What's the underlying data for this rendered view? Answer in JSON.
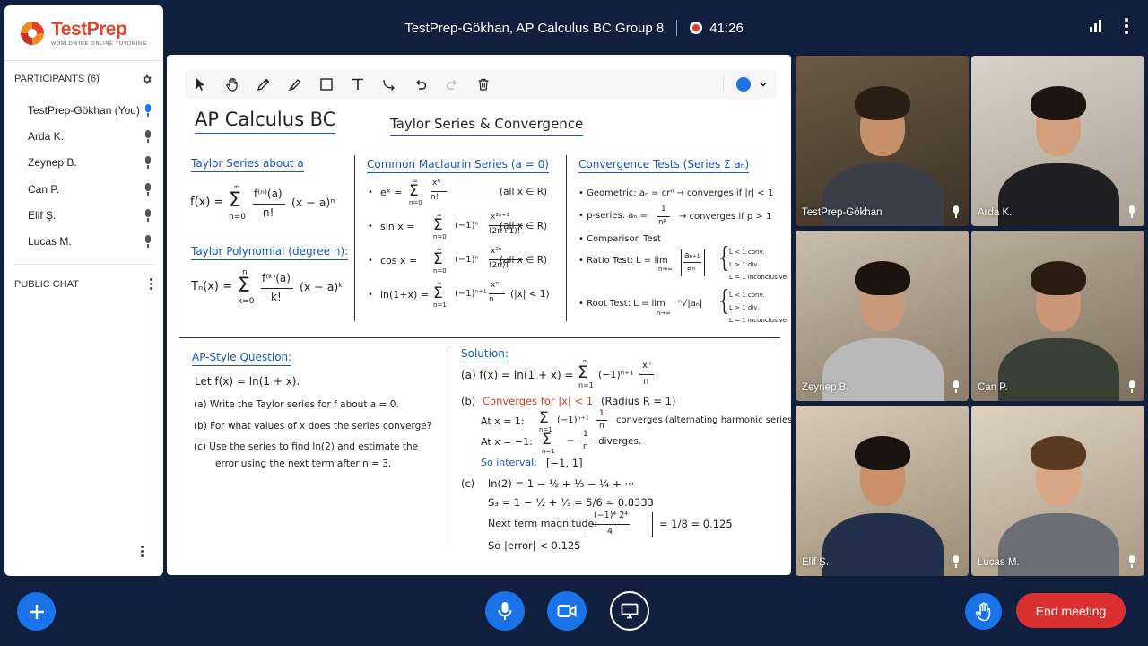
{
  "meeting": {
    "title": "TestPrep-Gökhan, AP Calculus BC Group 8",
    "recording_time": "41:26"
  },
  "brand": {
    "name_a": "Test",
    "name_b": "Prep",
    "tagline": "WORLDWIDE ONLINE TUTORING"
  },
  "sidebar": {
    "participants_header": "PARTICIPANTS (6)",
    "participants": [
      {
        "name": "TestPrep-Gökhan (You)",
        "mic_active": true
      },
      {
        "name": "Arda K.",
        "mic_active": false
      },
      {
        "name": "Zeynep B.",
        "mic_active": false
      },
      {
        "name": "Can P.",
        "mic_active": false
      },
      {
        "name": "Elif Ş.",
        "mic_active": false
      },
      {
        "name": "Lucas M.",
        "mic_active": false
      }
    ],
    "chat_header": "PUBLIC CHAT"
  },
  "whiteboard": {
    "tools": [
      "select-icon",
      "hand-icon",
      "pencil-icon",
      "marker-icon",
      "rectangle-icon",
      "text-icon",
      "connector-icon",
      "undo-icon",
      "redo-icon",
      "delete-icon"
    ],
    "selected_color": "#1a73e8",
    "title": "AP Calculus BC",
    "subtitle": "Taylor Series & Convergence",
    "taylor": {
      "heading": "Taylor Series about a",
      "formula_lhs": "f(x) =",
      "sum_top": "∞",
      "sum_bottom": "n=0",
      "num": "f⁽ⁿ⁾(a)",
      "den": "n!",
      "tail": "(x − a)ⁿ",
      "poly_heading": "Taylor Polynomial (degree n):",
      "poly_lhs": "Tₙ(x) =",
      "poly_top": "n",
      "poly_bottom": "k=0",
      "poly_num": "f⁽ᵏ⁾(a)",
      "poly_den": "k!",
      "poly_tail": "(x − a)ᵏ"
    },
    "maclaurin": {
      "heading": "Common Maclaurin Series (a = 0)",
      "rows": [
        {
          "lhs": "eˣ =",
          "mid": "",
          "num": "xⁿ",
          "den": "n!",
          "cond": "(all x ∈ R)",
          "bottom": "n=0"
        },
        {
          "lhs": "sin x =",
          "mid": "(−1)ⁿ",
          "num": "x²ⁿ⁺¹",
          "den": "(2n+1)!",
          "cond": "(all x ∈ R)",
          "bottom": "n=0"
        },
        {
          "lhs": "cos x =",
          "mid": "(−1)ⁿ",
          "num": "x²ⁿ",
          "den": "(2n)!",
          "cond": "(all x ∈ R)",
          "bottom": "n=0"
        },
        {
          "lhs": "ln(1+x) =",
          "mid": "(−1)ⁿ⁺¹",
          "num": "xⁿ",
          "den": "n",
          "cond": "(|x| < 1)",
          "bottom": "n=1"
        }
      ]
    },
    "tests": {
      "heading": "Convergence Tests (Series Σ aₙ)",
      "geometric": "Geometric:  aₙ = crⁿ  →  converges if |r| < 1",
      "pseries_a": "p-series:  aₙ =",
      "pseries_num": "1",
      "pseries_den": "nᵖ",
      "pseries_b": "→  converges if  p > 1",
      "comparison": "Comparison Test",
      "ratio_lhs": "Ratio Test:   L = lim",
      "ratio_sub": "n→∞",
      "ratio_num": "aₙ₊₁",
      "ratio_den": "aₙ",
      "root_lhs": "Root Test:   L = lim",
      "root_sub": "n→∞",
      "root_rad": "ⁿ√|aₙ|",
      "cases": [
        "L < 1  conv.",
        "L > 1  div.",
        "L = 1  inconclusive"
      ]
    },
    "question": {
      "heading": "AP-Style Question:",
      "let": "Let  f(x) = ln(1 + x).",
      "a": "(a)  Write the Taylor series for f about a = 0.",
      "b": "(b)  For what values of x does the series converge?",
      "c1": "(c)  Use the series to find ln(2) and estimate the",
      "c2": "error using the next term after n = 3."
    },
    "solution": {
      "heading": "Solution:",
      "a_lhs": "(a)   f(x) = ln(1 + x) =",
      "a_mid": "(−1)ⁿ⁺¹",
      "a_num": "xⁿ",
      "a_den": "n",
      "a_top": "∞",
      "a_bottom": "n=1",
      "b_label": "(b)",
      "b_red": "Converges for |x| < 1",
      "b_radius": "(Radius R = 1)",
      "x1_a": "At  x = 1:",
      "x1_mid": "(−1)ⁿ⁺¹",
      "x1_num": "1",
      "x1_den": "n",
      "x1_b": "converges (alternating harmonic series)",
      "xm1_a": "At  x = −1:",
      "xm1_mid": "−",
      "xm1_num": "1",
      "xm1_den": "n",
      "xm1_b": "diverges.",
      "interval_label": "So interval:",
      "interval": "[−1, 1]",
      "c_label": "(c)",
      "c_line1": "ln(2) = 1 − ½ + ⅓ − ¼ + ···",
      "c_line2": "S₃ = 1 − ½ + ⅓ = 5/6 ≈ 0.8333",
      "c_line3_a": "Next term magnitude:",
      "c_line3_num": "(−1)⁴ 2⁴",
      "c_line3_den": "4",
      "c_line3_b": "=  1/8  = 0.125",
      "c_line4": "So  |error|  <  0.125"
    }
  },
  "videos": [
    {
      "name": "TestPrep-Gökhan"
    },
    {
      "name": "Arda K."
    },
    {
      "name": "Zeynep B."
    },
    {
      "name": "Can P."
    },
    {
      "name": "Elif Ş."
    },
    {
      "name": "Lucas M."
    }
  ],
  "controls": {
    "end_label": "End meeting",
    "colors": {
      "primary": "#1a73e8",
      "end": "#dc2f2f"
    }
  }
}
